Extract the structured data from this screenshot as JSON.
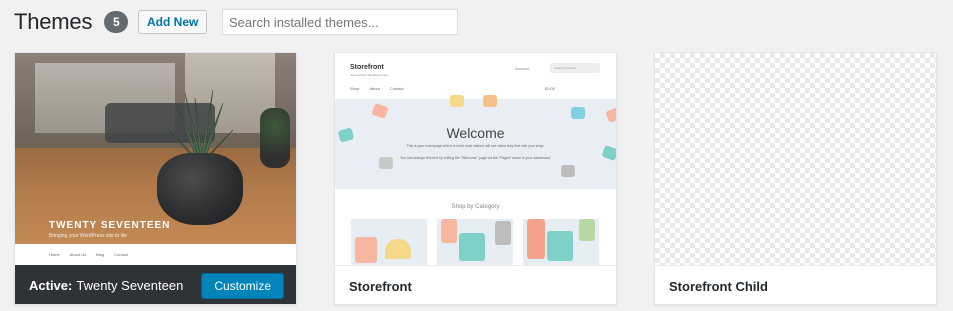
{
  "header": {
    "title": "Themes",
    "count": "5",
    "add_new_label": "Add New",
    "search_placeholder": "Search installed themes..."
  },
  "themes": [
    {
      "name": "Twenty Seventeen",
      "active": true,
      "active_prefix": "Active:",
      "action_label": "Customize",
      "preview": {
        "title": "TWENTY SEVENTEEN",
        "subtitle": "Bringing your WordPress site to life",
        "nav": [
          "Home",
          "About Us",
          "Blog",
          "Contact"
        ]
      }
    },
    {
      "name": "Storefront",
      "active": false,
      "preview": {
        "logo": "Storefront",
        "tagline": "Just another WordPress site",
        "account": "Account",
        "search": "Search products…",
        "menu": [
          "Shop",
          "About",
          "Contact"
        ],
        "cart": "£0.00",
        "hero_title": "Welcome",
        "hero_text_1": "This is your homepage which is what most visitors will see when they first visit your shop.",
        "hero_text_2": "You can change this text by editing the \"Welcome\" page via the \"Pages\" menu in your dashboard.",
        "section_title": "Shop by Category"
      }
    },
    {
      "name": "Storefront Child",
      "active": false
    }
  ],
  "colors": {
    "accent": "#0085ba",
    "active_bar": "#2f3236",
    "badge": "#656a6f",
    "link": "#0073aa"
  }
}
